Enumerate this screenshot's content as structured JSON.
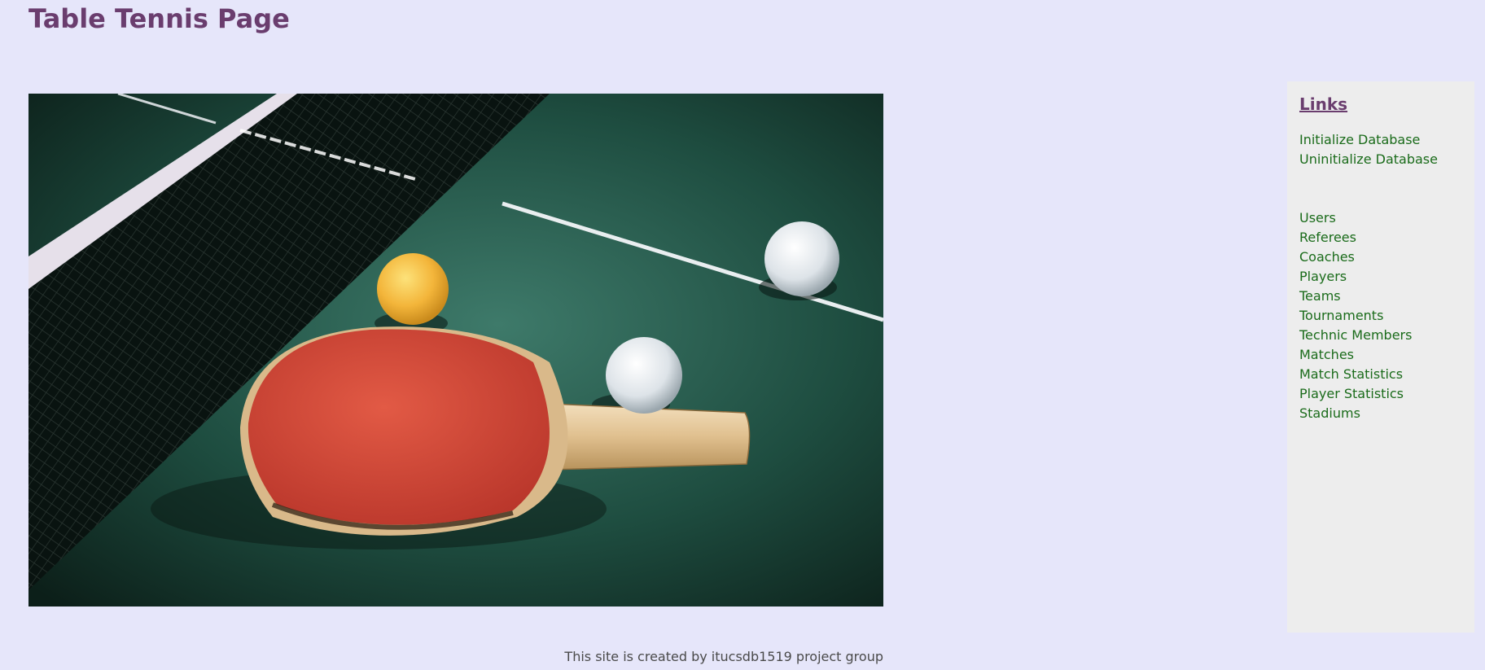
{
  "header": {
    "title": "Table Tennis Page"
  },
  "hero": {
    "subject": "paddle, balls and net on a table tennis table"
  },
  "sidebar": {
    "heading": "Links",
    "db_links": [
      {
        "label": "Initialize Database"
      },
      {
        "label": "Uninitialize Database"
      }
    ],
    "nav_links": [
      {
        "label": "Users"
      },
      {
        "label": "Referees"
      },
      {
        "label": "Coaches"
      },
      {
        "label": "Players"
      },
      {
        "label": "Teams"
      },
      {
        "label": "Tournaments"
      },
      {
        "label": "Technic Members"
      },
      {
        "label": "Matches"
      },
      {
        "label": "Match Statistics"
      },
      {
        "label": "Player Statistics"
      },
      {
        "label": "Stadiums"
      }
    ]
  },
  "footer": {
    "text": "This site is created by itucsdb1519 project group"
  },
  "colors": {
    "background": "#e6e6fa",
    "title": "#6a3d6e",
    "link": "#1a6b1a",
    "sidebar_bg": "#ededed"
  }
}
